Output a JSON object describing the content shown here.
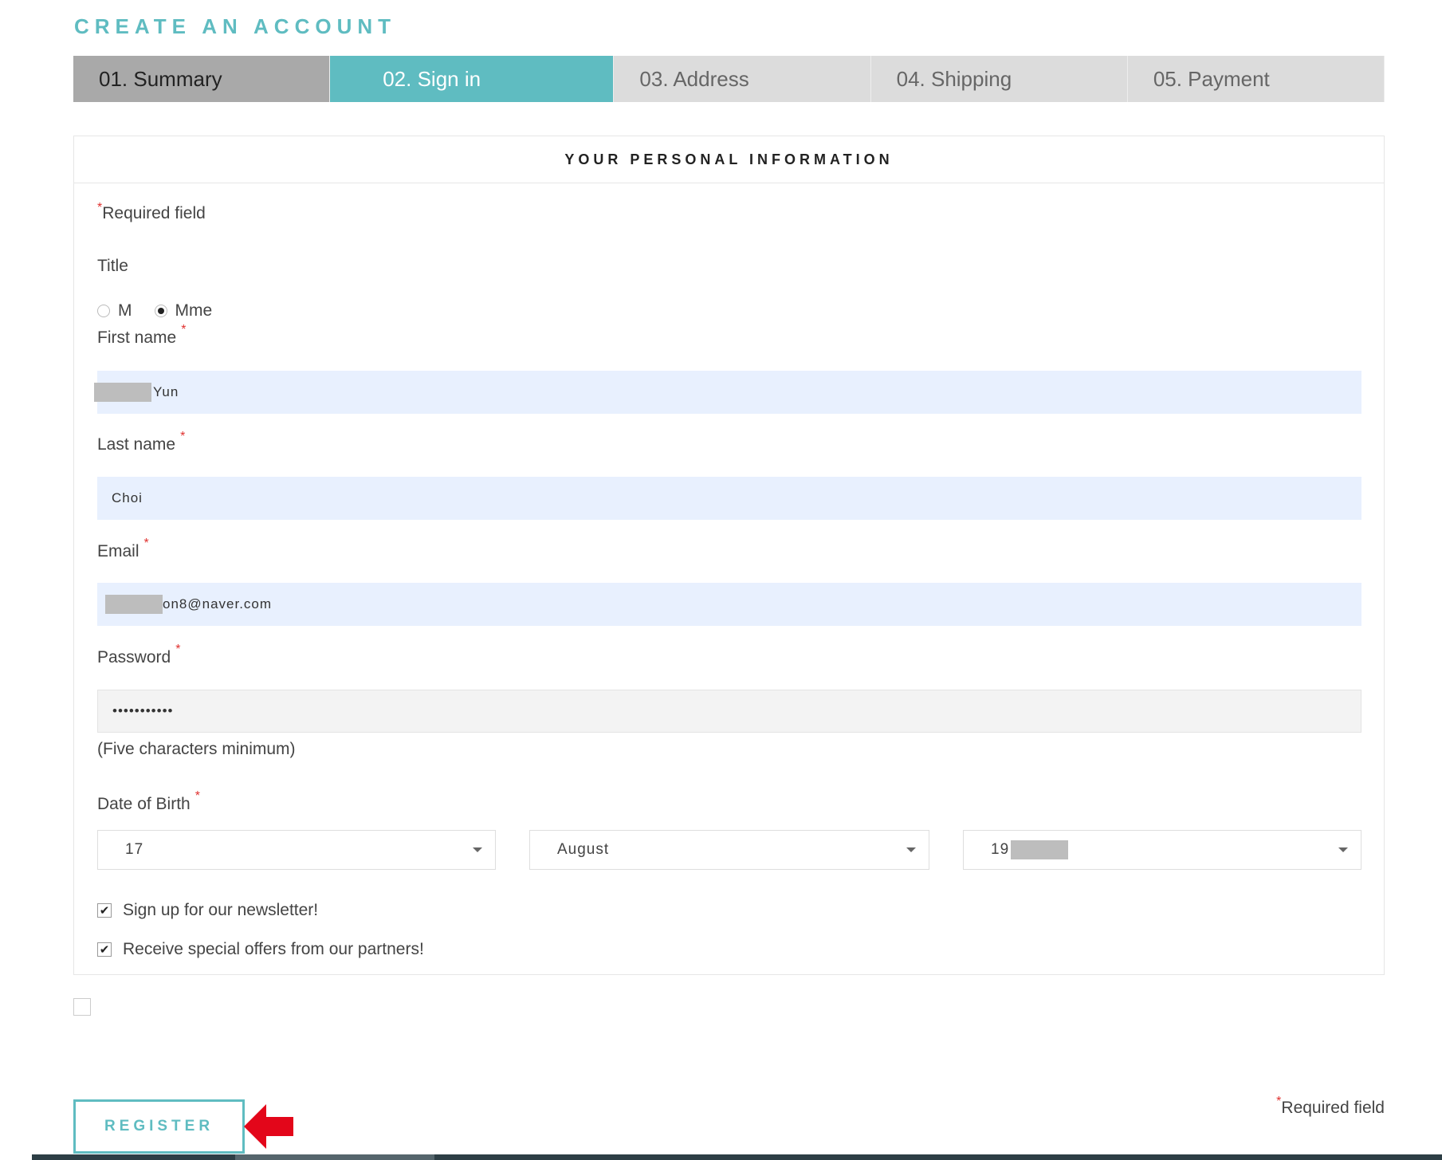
{
  "page": {
    "title": "CREATE AN ACCOUNT"
  },
  "steps": [
    {
      "label": "01. Summary",
      "state": "done"
    },
    {
      "label": "02. Sign in",
      "state": "active"
    },
    {
      "label": "03. Address",
      "state": "todo"
    },
    {
      "label": "04. Shipping",
      "state": "todo"
    },
    {
      "label": "05. Payment",
      "state": "todo"
    }
  ],
  "form": {
    "heading": "YOUR PERSONAL INFORMATION",
    "required_note": "Required field",
    "title_label": "Title",
    "title_options": [
      {
        "label": "M",
        "checked": false
      },
      {
        "label": "Mme",
        "checked": true
      }
    ],
    "first_name": {
      "label": "First name",
      "value": "Yun"
    },
    "last_name": {
      "label": "Last name",
      "value": "Choi"
    },
    "email": {
      "label": "Email",
      "value": "on8@naver.com"
    },
    "password": {
      "label": "Password",
      "value": "•••••••••••",
      "hint": "(Five characters minimum)"
    },
    "dob": {
      "label": "Date of Birth",
      "day": "17",
      "month": "August",
      "year": "19"
    },
    "newsletter": {
      "label": "Sign up for our newsletter!",
      "checked": true
    },
    "partners": {
      "label": "Receive special offers from our partners!",
      "checked": true
    }
  },
  "actions": {
    "register_label": "REGISTER",
    "required_note": "Required field"
  },
  "colors": {
    "accent": "#5fbcc1",
    "required": "#e0312f",
    "arrow": "#e3061a"
  }
}
